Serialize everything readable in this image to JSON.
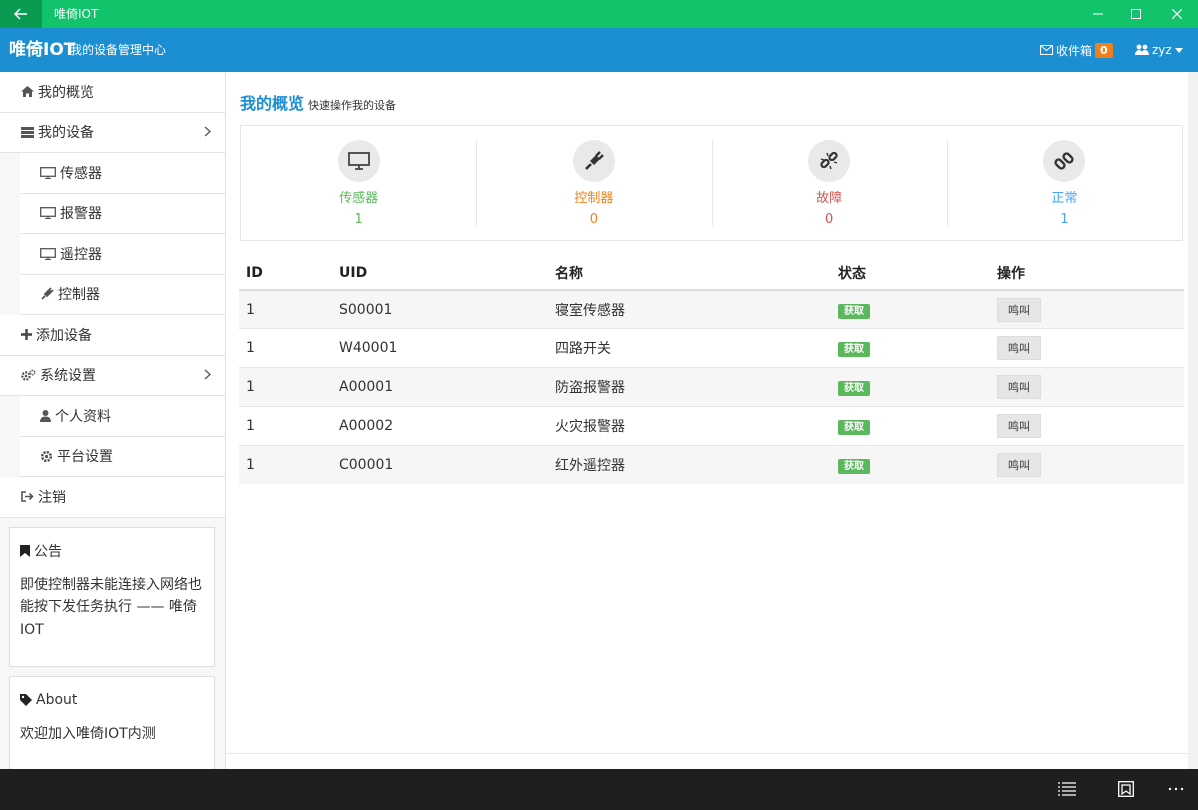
{
  "window": {
    "title": "唯倚IOT"
  },
  "header": {
    "brand": "唯倚IOT",
    "subtitle": "我的设备管理中心",
    "inbox_label": "收件箱",
    "inbox_count": "0",
    "user": "zyz"
  },
  "sidebar": {
    "overview": "我的概览",
    "devices": "我的设备",
    "sensor": "传感器",
    "alarm": "报警器",
    "remote": "遥控器",
    "controller": "控制器",
    "add_device": "添加设备",
    "settings": "系统设置",
    "profile": "个人资料",
    "platform": "平台设置",
    "logout": "注销",
    "notice_title": "公告",
    "notice_body": "即使控制器未能连接入网络也能按下发任务执行 —— 唯倚IOT",
    "about_title": "About",
    "about_body": "欢迎加入唯倚IOT内测"
  },
  "main": {
    "title": "我的概览",
    "subtitle": "快速操作我的设备",
    "stats": [
      {
        "label": "传感器",
        "value": "1",
        "color": "#5cb85c",
        "icon": "monitor-icon"
      },
      {
        "label": "控制器",
        "value": "0",
        "color": "#f0801c",
        "icon": "plug-icon"
      },
      {
        "label": "故障",
        "value": "0",
        "color": "#d9534f",
        "icon": "broken-link-icon"
      },
      {
        "label": "正常",
        "value": "1",
        "color": "#3fa9f5",
        "icon": "link-icon"
      }
    ],
    "table": {
      "headers": [
        "ID",
        "UID",
        "名称",
        "状态",
        "操作"
      ],
      "rows": [
        {
          "id": "1",
          "uid": "S00001",
          "name": "寝室传感器",
          "status": "获取",
          "action": "鸣叫"
        },
        {
          "id": "1",
          "uid": "W40001",
          "name": "四路开关",
          "status": "获取",
          "action": "鸣叫"
        },
        {
          "id": "1",
          "uid": "A00001",
          "name": "防盗报警器",
          "status": "获取",
          "action": "鸣叫"
        },
        {
          "id": "1",
          "uid": "A00002",
          "name": "火灾报警器",
          "status": "获取",
          "action": "鸣叫"
        },
        {
          "id": "1",
          "uid": "C00001",
          "name": "红外遥控器",
          "status": "获取",
          "action": "鸣叫"
        }
      ]
    }
  }
}
